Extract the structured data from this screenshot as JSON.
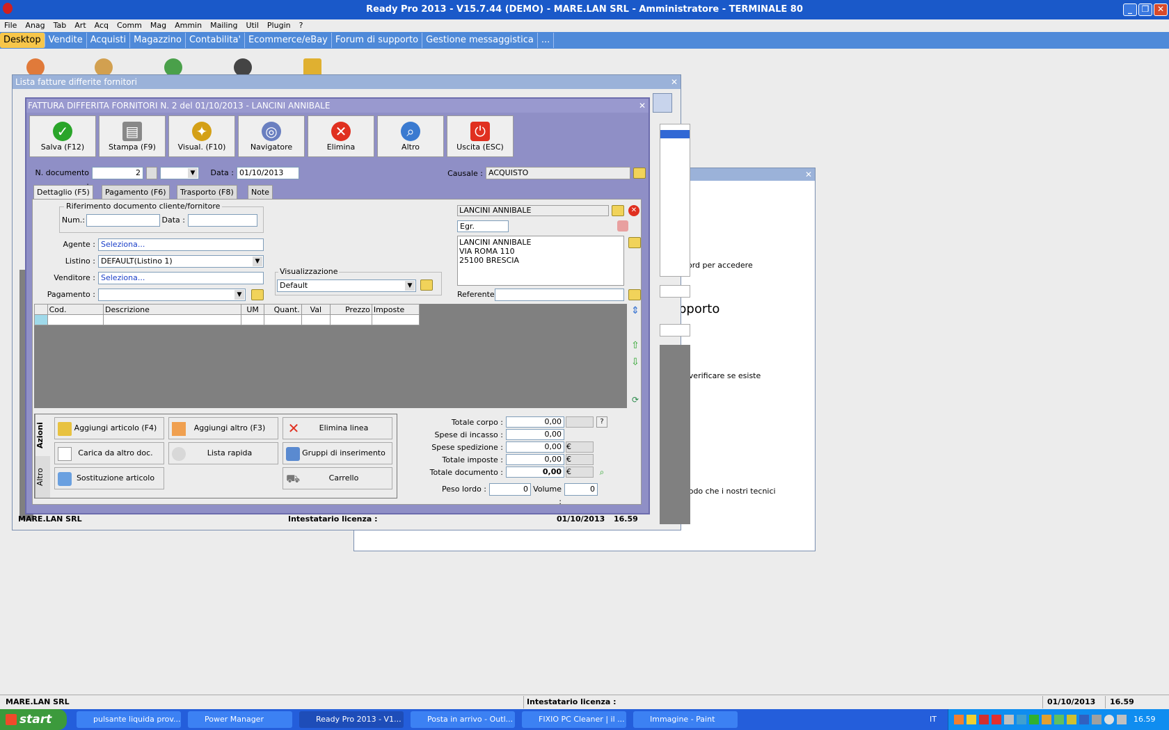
{
  "window_title": "Ready Pro 2013 - V15.7.44 (DEMO)  - MARE.LAN SRL - Amministratore - TERMINALE 80",
  "menu": [
    "File",
    "Anag",
    "Tab",
    "Art",
    "Acq",
    "Comm",
    "Mag",
    "Ammin",
    "Mailing",
    "Util",
    "Plugin",
    "?"
  ],
  "tabs": [
    "Desktop",
    "Vendite",
    "Acquisti",
    "Magazzino",
    "Contabilita'",
    "Ecommerce/eBay",
    "Forum di supporto",
    "Gestione messaggistica",
    "..."
  ],
  "list_window": {
    "title": "Lista fatture differite fornitori"
  },
  "bg_window": {
    "text1": "word per accedere",
    "heading": "pporto",
    "text2": "er verificare se esiste",
    "text3": "modo che i nostri tecnici"
  },
  "main": {
    "title": "FATTURA DIFFERITA FORNITORI N. 2 del 01/10/2013 - LANCINI ANNIBALE",
    "toolbar": [
      {
        "label": "Salva (F12)",
        "icon": "check-icon",
        "color": "#2aa52a"
      },
      {
        "label": "Stampa (F9)",
        "icon": "printer-icon",
        "color": "#888888"
      },
      {
        "label": "Visual. (F10)",
        "icon": "wand-icon",
        "color": "#d4a017"
      },
      {
        "label": "Navigatore",
        "icon": "compass-icon",
        "color": "#6a7fc0"
      },
      {
        "label": "Elimina",
        "icon": "cross-icon",
        "color": "#e03020"
      },
      {
        "label": "Altro",
        "icon": "magnifier-icon",
        "color": "#3a7ad0"
      },
      {
        "label": "Uscita (ESC)",
        "icon": "power-icon",
        "color": "#e03020"
      }
    ],
    "ndoc_label": "N. documento :",
    "ndoc_value": "2",
    "data_label": "Data :",
    "data_value": "01/10/2013",
    "causale_label": "Causale :",
    "causale_value": "ACQUISTO",
    "subtabs": [
      "Dettaglio (F5)",
      "Pagamento (F6)",
      "Trasporto (F8)",
      "Note"
    ],
    "rif_title": "Riferimento documento cliente/fornitore",
    "num_label": "Num.:",
    "rdata_label": "Data :",
    "agente_label": "Agente :",
    "agente_value": "Seleziona...",
    "listino_label": "Listino :",
    "listino_value": "DEFAULT(Listino 1)",
    "venditore_label": "Venditore :",
    "venditore_value": "Seleziona...",
    "pagamento_label": "Pagamento :",
    "vis_title": "Visualizzazione",
    "vis_value": "Default",
    "cliente": "LANCINI ANNIBALE",
    "titolo": "Egr.",
    "address": [
      "LANCINI ANNIBALE",
      "VIA ROMA 110",
      "25100 BRESCIA"
    ],
    "referente_label": "Referente",
    "grid_headers": [
      "Cod.",
      "Descrizione",
      "UM",
      "Quant.",
      "Val",
      "Prezzo",
      "Imposte"
    ],
    "side_tabs": [
      "Azioni",
      "Altro"
    ],
    "actions": [
      "Aggiungi articolo (F4)",
      "Aggiungi altro (F3)",
      "Elimina linea",
      "Carica da altro doc.",
      "Lista rapida",
      "Gruppi di inserimento",
      "Sostituzione articolo",
      "Carrello"
    ],
    "totals": [
      {
        "label": "Totale corpo :",
        "value": "0,00"
      },
      {
        "label": "Spese di incasso :",
        "value": "0,00"
      },
      {
        "label": "Spese spedizione :",
        "value": "0,00"
      },
      {
        "label": "Totale imposte :",
        "value": "0,00"
      },
      {
        "label": "Totale documento :",
        "value": "0,00"
      }
    ],
    "help_label": "?",
    "euro": "€",
    "peso_label": "Peso lordo :",
    "peso_value": "0",
    "volume_label": "Volume :",
    "volume_value": "0"
  },
  "inner_status": {
    "company": "MARE.LAN SRL",
    "licenza": "Intestatario licenza :",
    "date": "01/10/2013",
    "time": "16.59"
  },
  "status": {
    "company": "MARE.LAN SRL",
    "licenza": "Intestatario licenza :",
    "date": "01/10/2013",
    "time": "16.59"
  },
  "taskbar": {
    "start": "start",
    "items": [
      "pulsante liquida prov...",
      "Power Manager",
      "Ready Pro 2013 - V1...",
      "Posta in arrivo - Outl...",
      "FIXIO PC Cleaner | il ...",
      "Immagine - Paint"
    ],
    "lang": "IT",
    "clock": "16.59"
  }
}
